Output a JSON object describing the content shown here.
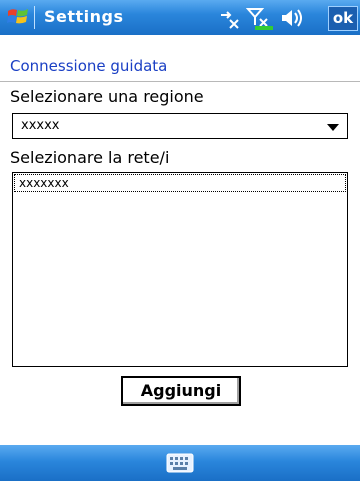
{
  "titlebar": {
    "title": "Settings",
    "ok_label": "ok",
    "icons": [
      "windows-start-icon",
      "connectivity-icon",
      "signal-off-icon",
      "volume-icon"
    ]
  },
  "page": {
    "heading": "Connessione guidata",
    "region_label": "Selezionare una regione",
    "region_value": "xxxxx",
    "network_label": "Selezionare la rete/i",
    "networks": [
      "xxxxxxx"
    ],
    "add_button": "Aggiungi"
  },
  "bottombar": {
    "icons": [
      "keyboard-icon"
    ]
  },
  "colors": {
    "bar_blue": "#2a86dc",
    "heading_blue": "#1a3fc4"
  }
}
